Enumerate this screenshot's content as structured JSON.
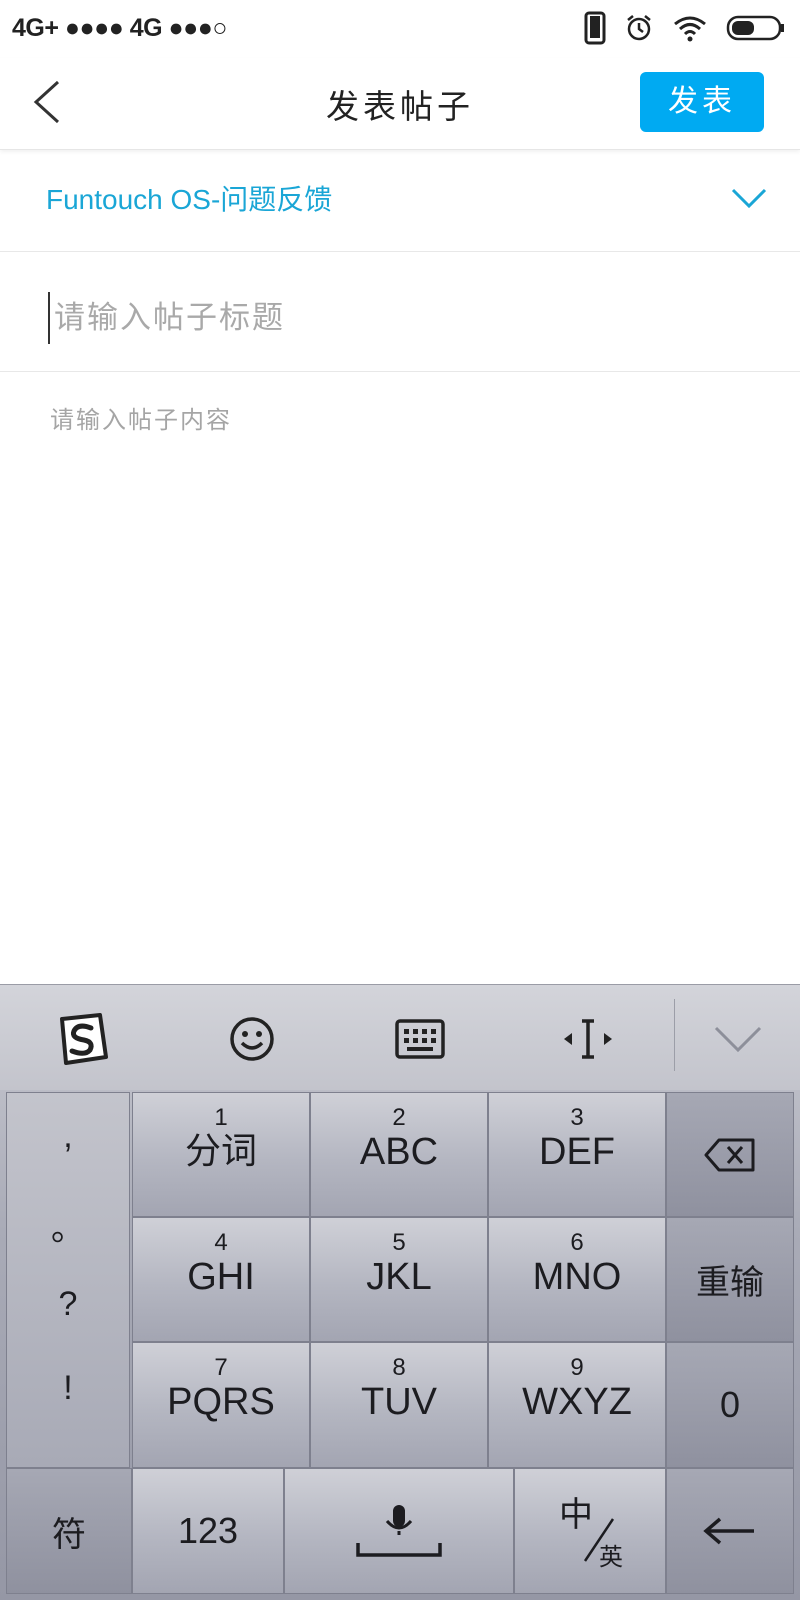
{
  "status_bar": {
    "carrier_text": "4G+ ●●●● 4G ●●●○"
  },
  "header": {
    "title": "发表帖子",
    "post_button_label": "发表"
  },
  "form": {
    "category": "Funtouch OS-问题反馈",
    "title_placeholder": "请输入帖子标题",
    "content_placeholder": "请输入帖子内容"
  },
  "keyboard": {
    "toolbar_icons": [
      "sogou-logo-icon",
      "emoji-icon",
      "keyboard-icon",
      "cursor-move-icon",
      "collapse-keyboard-icon"
    ],
    "punctuation": [
      ",",
      "。",
      "?",
      "!"
    ],
    "keys": [
      {
        "num": "1",
        "label": "分词"
      },
      {
        "num": "2",
        "label": "ABC"
      },
      {
        "num": "3",
        "label": "DEF"
      },
      {
        "num": "4",
        "label": "GHI"
      },
      {
        "num": "5",
        "label": "JKL"
      },
      {
        "num": "6",
        "label": "MNO"
      },
      {
        "num": "7",
        "label": "PQRS"
      },
      {
        "num": "8",
        "label": "TUV"
      },
      {
        "num": "9",
        "label": "WXYZ"
      }
    ],
    "reinput_label": "重输",
    "zero_label": "0",
    "symbol_label": "符",
    "numeric_label": "123",
    "lang_main": "中",
    "lang_sub": "英"
  }
}
